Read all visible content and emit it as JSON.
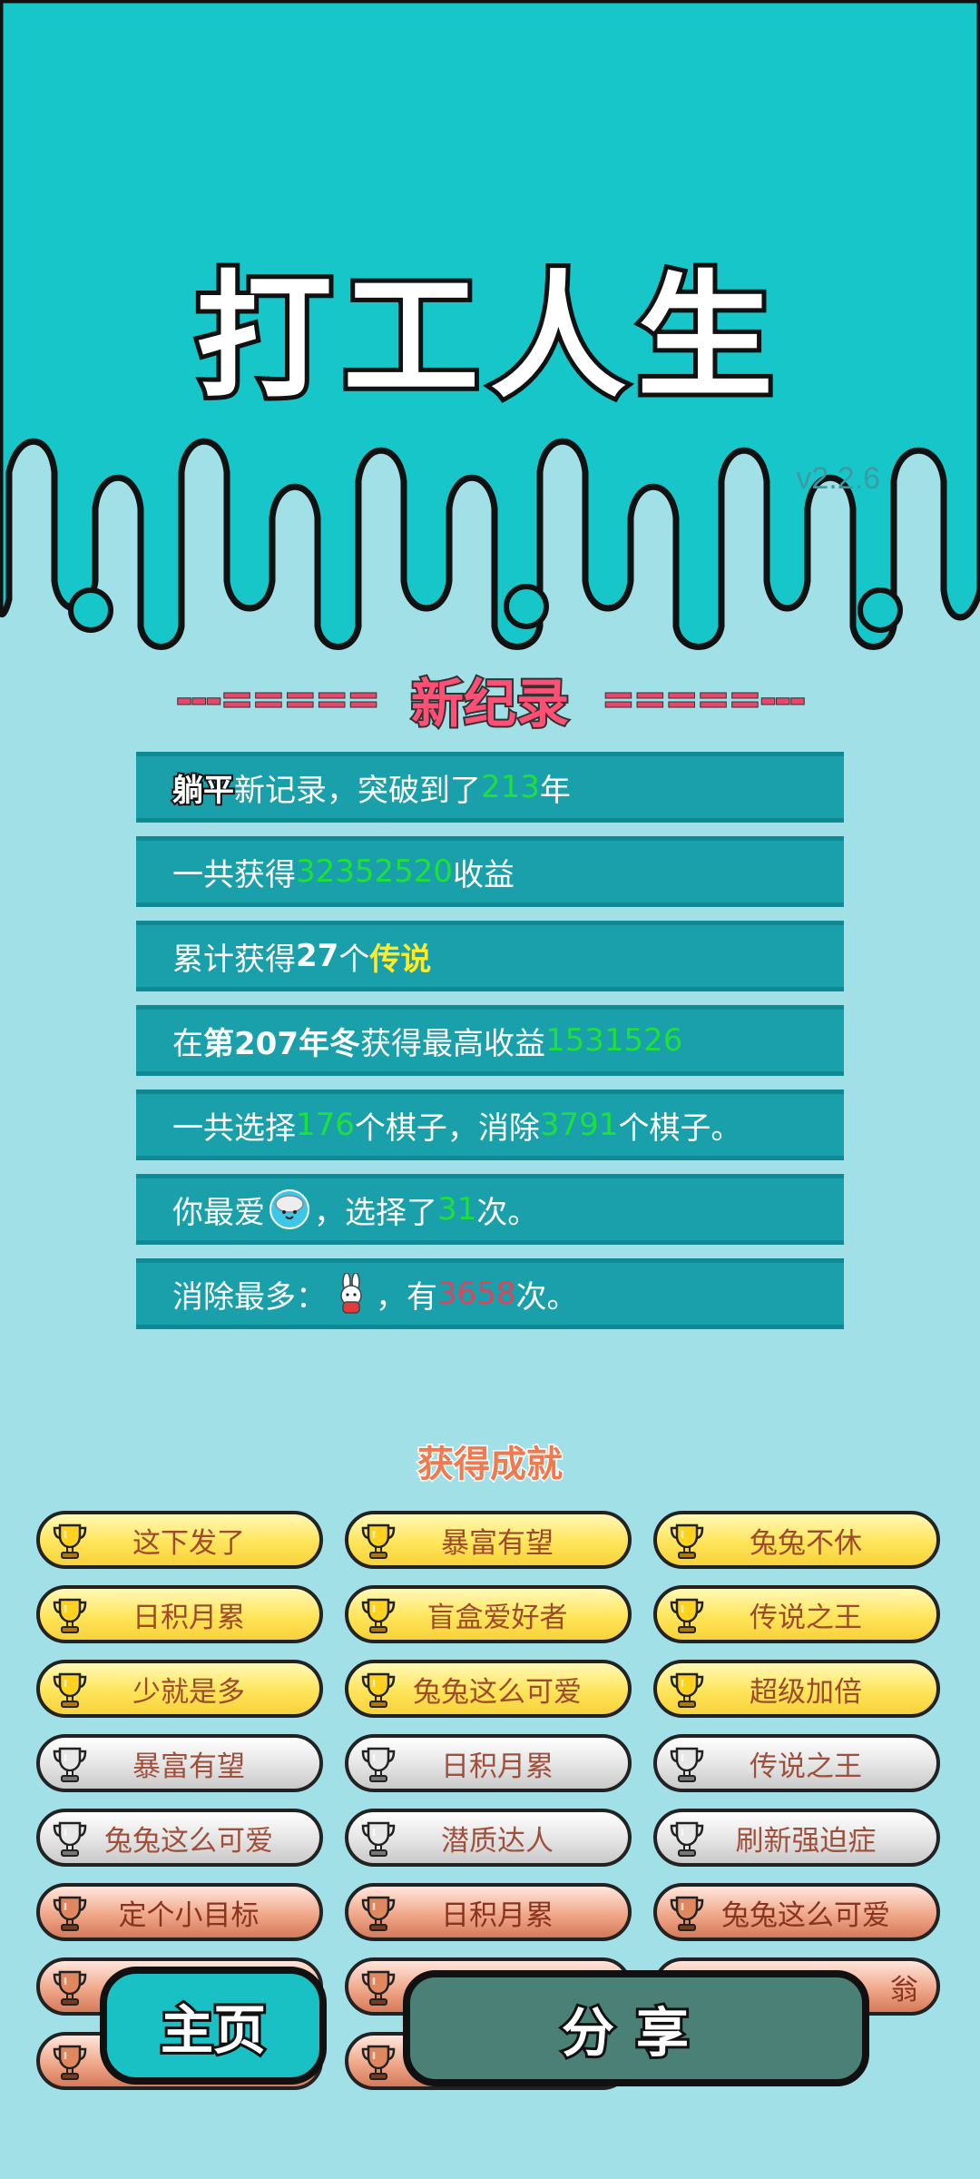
{
  "app_title": "打工人生",
  "version": "v2.2.6",
  "record_heading": {
    "left_dashes": "---=====",
    "title": "新纪录",
    "right_dashes": "=====---"
  },
  "stats": {
    "row1": {
      "tag": "躺平",
      "text1": "新记录，突破到了",
      "years": "213",
      "text2": "年"
    },
    "row2": {
      "text1": "一共获得",
      "income": "32352520",
      "text2": "收益"
    },
    "row3": {
      "text1": "累计获得",
      "count": "27",
      "text2": "个",
      "legend": "传说"
    },
    "row4": {
      "text1": "在 ",
      "season": "第207年冬",
      "text2": " 获得最高收益",
      "max_income": "1531526"
    },
    "row5": {
      "text1": "一共选择",
      "chosen": "176",
      "text2": "个棋子，消除",
      "cleared": "3791",
      "text3": "个棋子。"
    },
    "row6": {
      "text1": "你最爱",
      "text2": "，选择了",
      "times": "31",
      "text3": "次。",
      "icon": "rice-bowl-icon"
    },
    "row7": {
      "text1": "消除最多：",
      "text2": "，有",
      "times": "3658",
      "text3": "次。",
      "icon": "rabbit-icon"
    }
  },
  "achievements_title": "获得成就",
  "achievements": [
    {
      "label": "这下发了",
      "tier": "gold"
    },
    {
      "label": "暴富有望",
      "tier": "gold"
    },
    {
      "label": "兔兔不休",
      "tier": "gold"
    },
    {
      "label": "日积月累",
      "tier": "gold"
    },
    {
      "label": "盲盒爱好者",
      "tier": "gold"
    },
    {
      "label": "传说之王",
      "tier": "gold"
    },
    {
      "label": "少就是多",
      "tier": "gold"
    },
    {
      "label": "兔兔这么可爱",
      "tier": "gold"
    },
    {
      "label": "超级加倍",
      "tier": "gold"
    },
    {
      "label": "暴富有望",
      "tier": "silver"
    },
    {
      "label": "日积月累",
      "tier": "silver"
    },
    {
      "label": "传说之王",
      "tier": "silver"
    },
    {
      "label": "兔兔这么可爱",
      "tier": "silver"
    },
    {
      "label": "潜质达人",
      "tier": "silver"
    },
    {
      "label": "刷新强迫症",
      "tier": "silver"
    },
    {
      "label": "定个小目标",
      "tier": "bronze"
    },
    {
      "label": "日积月累",
      "tier": "bronze"
    },
    {
      "label": "兔兔这么可爱",
      "tier": "bronze"
    }
  ],
  "partial_row_text": "翁",
  "buttons": {
    "home": "主页",
    "share": "分享"
  },
  "colors": {
    "top": "#17c6c9",
    "background": "#a2e0e8",
    "row": "#1aa0aa",
    "highlight_green": "#1ee03a",
    "highlight_yellow": "#ffea2a",
    "highlight_red": "#e6405a"
  }
}
